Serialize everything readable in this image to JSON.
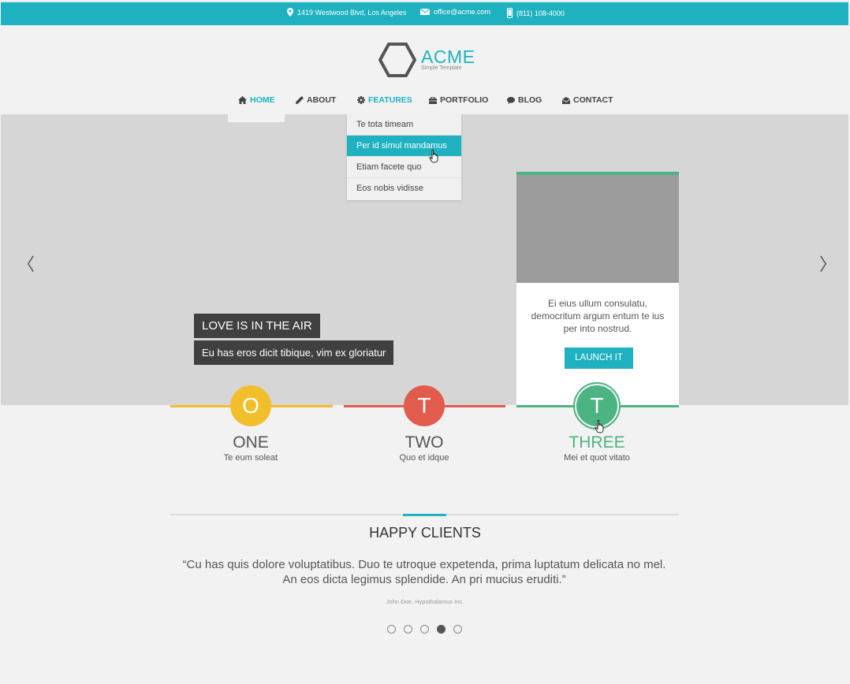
{
  "contact": {
    "address": "1419 Westwood Blvd, Los Angeles",
    "email": "office@acme.com",
    "phone": "(811) 108-4000"
  },
  "brand": {
    "name": "ACME",
    "tagline": "Simple Template"
  },
  "nav": {
    "items": [
      {
        "label": "HOME",
        "icon": "home-icon"
      },
      {
        "label": "ABOUT",
        "icon": "pencil-icon"
      },
      {
        "label": "FEATURES",
        "icon": "gear-icon"
      },
      {
        "label": "PORTFOLIO",
        "icon": "briefcase-icon"
      },
      {
        "label": "BLOG",
        "icon": "speech-bubble-icon"
      },
      {
        "label": "CONTACT",
        "icon": "envelope-icon"
      }
    ],
    "active": "HOME",
    "open_menu": "FEATURES"
  },
  "dropdown": {
    "items": [
      "Te tota timeam",
      "Per id simul mandamus",
      "Etiam facete quo",
      "Eos nobis vidisse"
    ],
    "highlighted": "Per id simul mandamus"
  },
  "slider": {
    "caption_title": "LOVE IS IN THE AIR",
    "caption_text": "Eu has eros dicit tibique, vim ex gloriatur",
    "prev_icon": "chevron-left-icon",
    "next_icon": "chevron-right-icon"
  },
  "card": {
    "text": "Ei eius ullum consulatu, democritum argum entum te ius per into nostrud.",
    "button_label": "LAUNCH IT"
  },
  "features": [
    {
      "letter": "O",
      "title": "ONE",
      "subtitle": "Te eum soleat",
      "color": "#f0bf2b"
    },
    {
      "letter": "T",
      "title": "TWO",
      "subtitle": "Quo et idque",
      "color": "#e25c4d"
    },
    {
      "letter": "T",
      "title": "THREE",
      "subtitle": "Mei et quot vitato",
      "color": "#4cb383"
    }
  ],
  "testimonials": {
    "heading": "HAPPY CLIENTS",
    "quote": "“Cu has quis dolore voluptatibus. Duo te utroque expetenda, prima luptatum delicata no mel. An eos dicta legimus splendide. An pri mucius eruditi.”",
    "author": "John Doe, Hypothalamus Inc.",
    "pages": 5,
    "active_page": 4
  },
  "colors": {
    "accent": "#1fb1c0",
    "dark_caption": "#404040",
    "hero_bg": "#d6d6d6"
  }
}
